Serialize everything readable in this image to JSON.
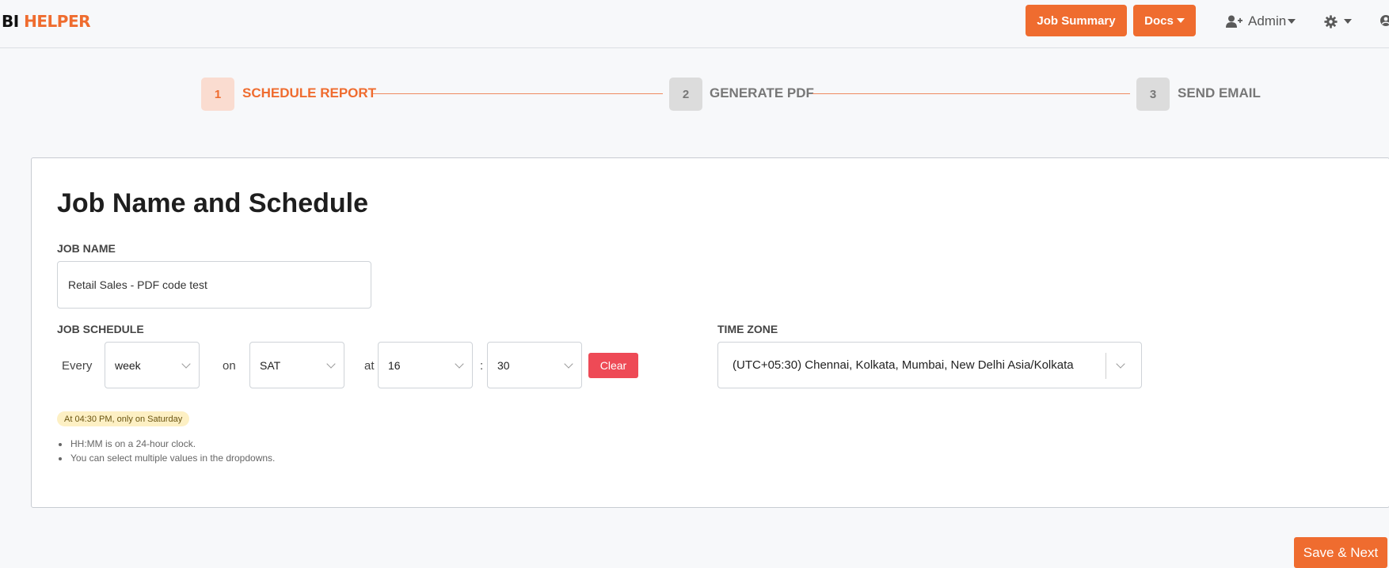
{
  "brand": {
    "part1": "BI",
    "part2": "HELPER"
  },
  "navbar": {
    "job_summary_label": "Job Summary",
    "docs_label": "Docs",
    "admin_label": "Admin"
  },
  "stepper": {
    "steps": [
      {
        "number": "1",
        "label": "SCHEDULE REPORT",
        "state": "active"
      },
      {
        "number": "2",
        "label": "GENERATE PDF",
        "state": "inactive"
      },
      {
        "number": "3",
        "label": "SEND EMAIL",
        "state": "inactive"
      }
    ]
  },
  "form": {
    "title": "Job Name and Schedule",
    "job_name_label": "JOB NAME",
    "job_name_value": "Retail Sales - PDF code test",
    "job_schedule_label": "JOB SCHEDULE",
    "every_word": "Every",
    "frequency_value": "week",
    "on_word": "on",
    "day_value": "SAT",
    "at_word": "at",
    "hour_value": "16",
    "colon": ":",
    "minute_value": "30",
    "clear_label": "Clear",
    "time_zone_label": "TIME ZONE",
    "time_zone_value": "(UTC+05:30) Chennai, Kolkata, Mumbai, New Delhi Asia/Kolkata",
    "schedule_summary": "At 04:30 PM, only on Saturday",
    "notes": [
      "HH:MM is on a 24-hour clock.",
      "You can select multiple values in the dropdowns."
    ]
  },
  "actions": {
    "save_next_label": "Save & Next"
  },
  "colors": {
    "accent": "#ef6c2f",
    "clear_button": "#ee4a56",
    "summary_badge_bg": "#fdf0c4"
  }
}
